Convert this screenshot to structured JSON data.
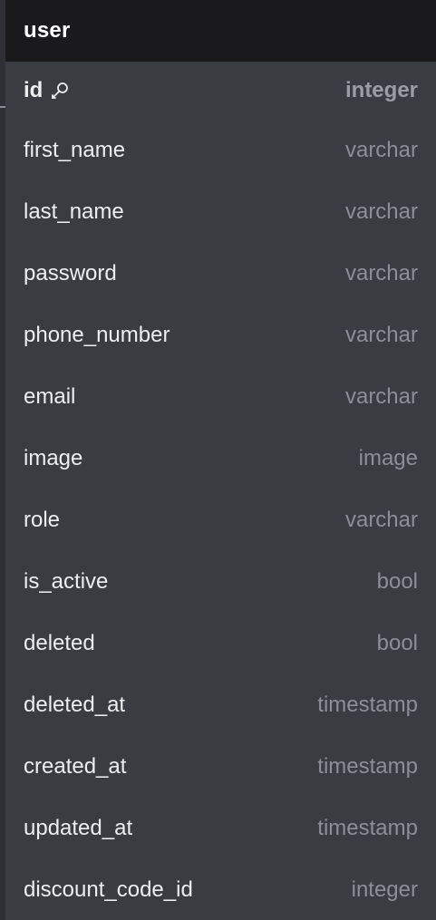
{
  "table": {
    "name": "user",
    "columns": [
      {
        "name": "id",
        "type": "integer",
        "primary_key": true,
        "icon": "key-icon"
      },
      {
        "name": "first_name",
        "type": "varchar",
        "primary_key": false
      },
      {
        "name": "last_name",
        "type": "varchar",
        "primary_key": false
      },
      {
        "name": "password",
        "type": "varchar",
        "primary_key": false
      },
      {
        "name": "phone_number",
        "type": "varchar",
        "primary_key": false
      },
      {
        "name": "email",
        "type": "varchar",
        "primary_key": false
      },
      {
        "name": "image",
        "type": "image",
        "primary_key": false
      },
      {
        "name": "role",
        "type": "varchar",
        "primary_key": false
      },
      {
        "name": "is_active",
        "type": "bool",
        "primary_key": false
      },
      {
        "name": "deleted",
        "type": "bool",
        "primary_key": false
      },
      {
        "name": "deleted_at",
        "type": "timestamp",
        "primary_key": false
      },
      {
        "name": "created_at",
        "type": "timestamp",
        "primary_key": false
      },
      {
        "name": "updated_at",
        "type": "timestamp",
        "primary_key": false
      },
      {
        "name": "discount_code_id",
        "type": "integer",
        "primary_key": false
      }
    ]
  },
  "colors": {
    "canvas": "#2e3035",
    "header_bg": "#1a1a1c",
    "table_bg": "#3b3c42",
    "column_name": "#eceef0",
    "column_type": "#8c8f95",
    "connector": "#8a8d93"
  }
}
